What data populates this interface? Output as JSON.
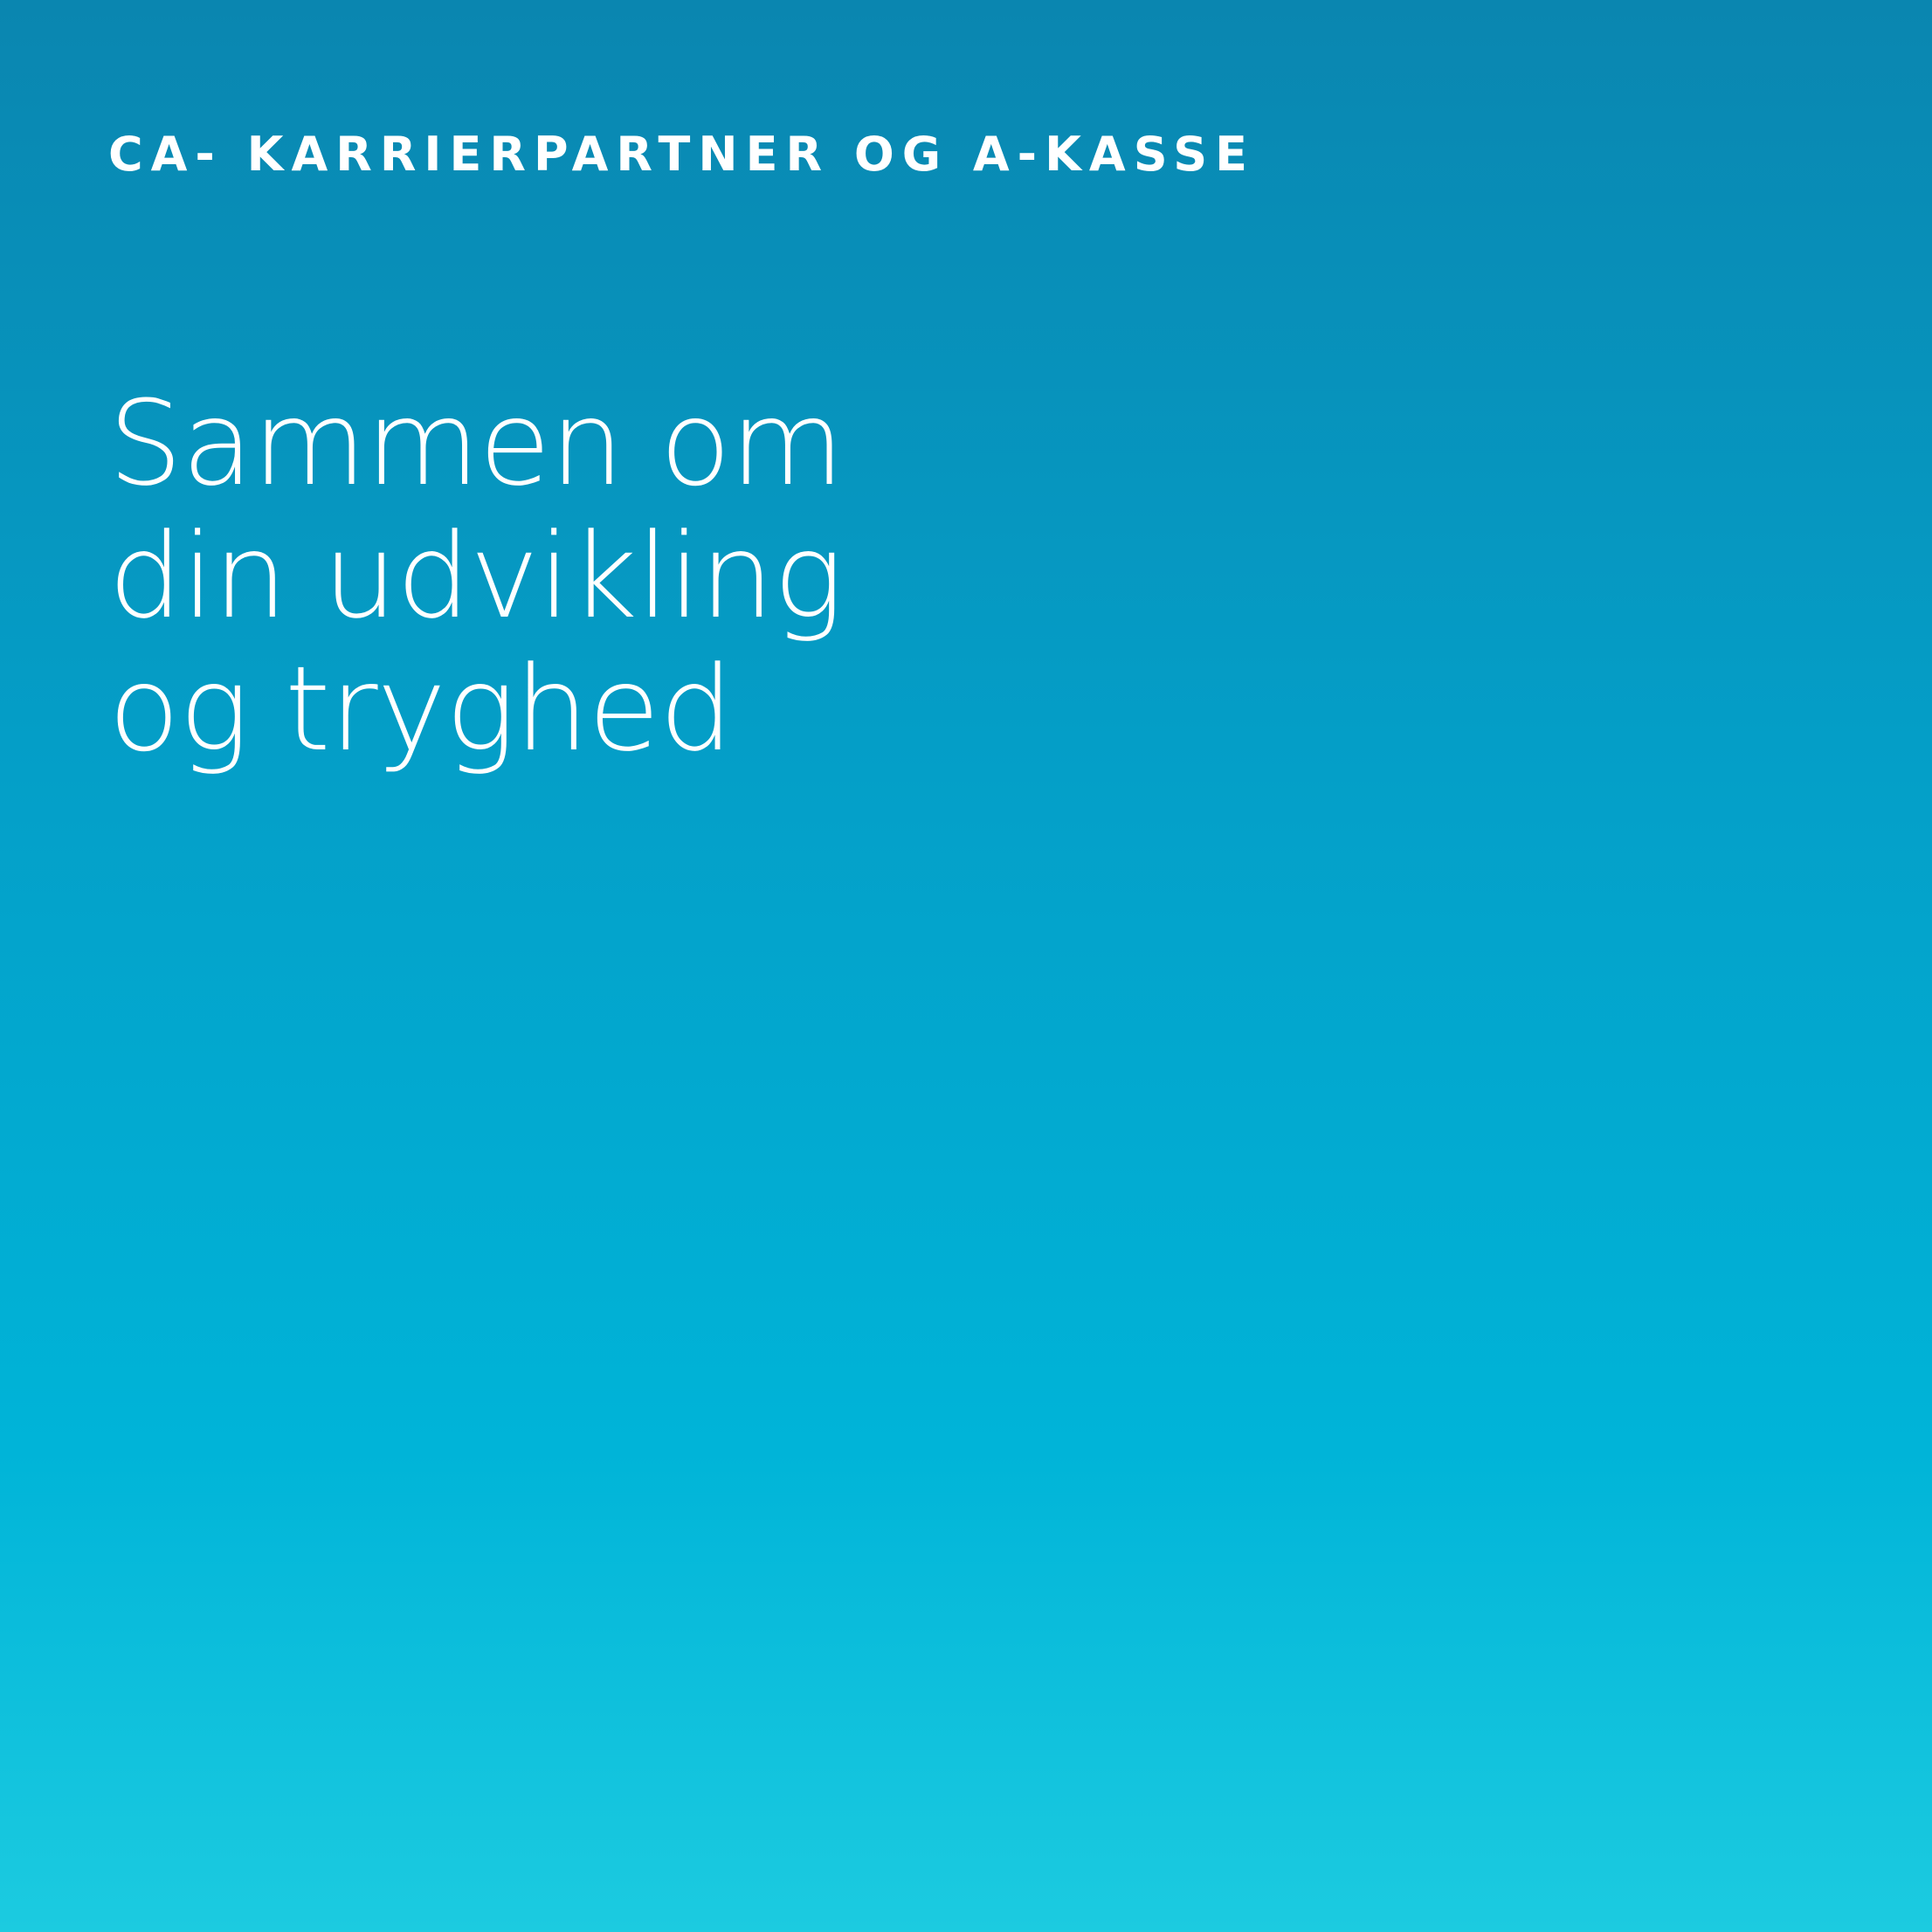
{
  "eyebrow": "CA- KARRIERPARTNER OG A-KASSE",
  "headline": {
    "lines": [
      "Sammen om",
      "din udvikling",
      "og tryghed"
    ]
  },
  "colors": {
    "gradient_top": "#0a86b0",
    "gradient_bottom": "#1ccbe0",
    "text": "#ffffff"
  }
}
